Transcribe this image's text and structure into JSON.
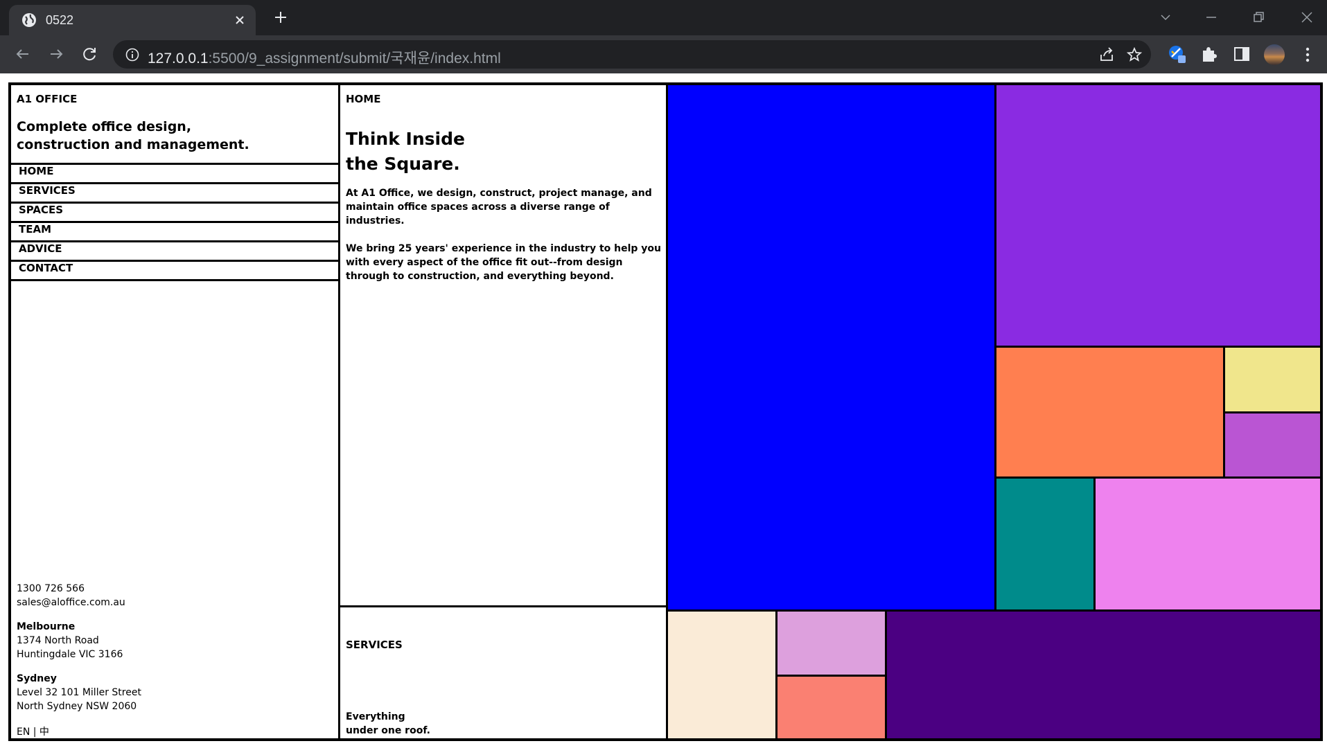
{
  "browser": {
    "tab_title": "0522",
    "url_host": "127.0.0.1",
    "url_rest": ":5500/9_assignment/submit/국재윤/index.html"
  },
  "site": {
    "brand": "A1 OFFICE",
    "tagline_line1": "Complete office design,",
    "tagline_line2": "construction and management.",
    "nav": [
      "HOME",
      "SERVICES",
      "SPACES",
      "TEAM",
      "ADVICE",
      "CONTACT"
    ],
    "contact": {
      "phone": "1300 726 566",
      "email": "sales@aloffice.com.au",
      "melbourne_label": "Melbourne",
      "melbourne_line1": "1374 North Road",
      "melbourne_line2": "Huntingdale VIC 3166",
      "sydney_label": "Sydney",
      "sydney_line1": "Level 32 101 Miller Street",
      "sydney_line2": "North Sydney NSW 2060"
    },
    "lang": "EN | 中"
  },
  "home": {
    "label": "HOME",
    "headline_line1": "Think Inside",
    "headline_line2": "the Square.",
    "para1": "At A1 Office, we design, construct, project manage, and maintain office spaces across a diverse range of industries.",
    "para2": "We bring 25 years' experience in the industry to help you with every aspect of the office fit out--from design through to construction, and everything beyond."
  },
  "services": {
    "label": "SERVICES",
    "sub_line1": "Everything",
    "sub_line2": "under one roof."
  },
  "colors": {
    "blue": "#0000ff",
    "blueviolet": "#8a2be2",
    "coral": "#ff7f50",
    "khaki": "#f0e68c",
    "mediumorchid": "#ba55d3",
    "teal": "#008b8b",
    "violet": "#ee82ee",
    "linen": "#faebd7",
    "plum": "#dda0dd",
    "salmon": "#fa8072",
    "indigo": "#4b0082"
  }
}
